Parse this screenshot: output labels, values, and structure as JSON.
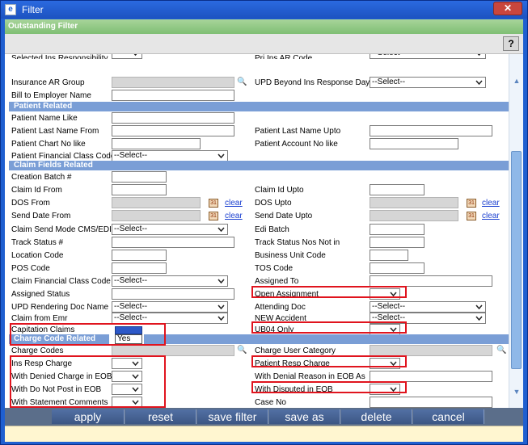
{
  "window": {
    "title": "Filter",
    "close_label": "✕",
    "icon_label": "e"
  },
  "header": {
    "title": "Outstanding Filter"
  },
  "toolbar": {
    "help_label": "?"
  },
  "select_placeholder": "--Select--",
  "rows": {
    "selected_ins_responsibility": "Selected Ins Responsibility",
    "pri_ins_ar_code": "Pri Ins AR Code",
    "insurance_ar_group": "Insurance AR Group",
    "upd_beyond": "UPD Beyond Ins Response Days",
    "bill_to_employer": "Bill to Employer Name"
  },
  "patient": {
    "section": "Patient Related",
    "name_like": "Patient Name Like",
    "last_name_from": "Patient Last Name From",
    "last_name_upto": "Patient Last Name Upto",
    "chart_no_like": "Patient Chart No like",
    "account_no_like": "Patient Account No like",
    "financial_class_code": "Patient Financial Class Code"
  },
  "claim": {
    "section": "Claim Fields Related",
    "creation_batch": "Creation Batch #",
    "claim_id_from": "Claim Id From",
    "claim_id_upto": "Claim Id Upto",
    "dos_from": "DOS From",
    "dos_upto": "DOS Upto",
    "send_date_from": "Send Date From",
    "send_date_upto": "Send Date Upto",
    "send_mode": "Claim Send Mode CMS/EDI",
    "edi_batch": "Edi Batch",
    "track_status": "Track Status #",
    "track_status_not_in": "Track Status Nos Not in",
    "location_code": "Location Code",
    "business_unit_code": "Business Unit Code",
    "pos_code": "POS Code",
    "tos_code": "TOS Code",
    "financial_class_code": "Claim Financial Class Code",
    "assigned_to": "Assigned To",
    "assigned_status": "Assigned Status",
    "open_assignment": "Open Assignment",
    "upd_rendering_doc": "UPD Rendering Doc Name",
    "attending_doc": "Attending Doc",
    "claim_from_emr": "Claim from Emr",
    "new_accident": "NEW Accident",
    "capitation_claims": "Capitation Claims",
    "capitation_value": "Yes",
    "ub04_only": "UB04 Only"
  },
  "charge": {
    "section": "Charge Code Related",
    "charge_codes": "Charge Codes",
    "charge_user_category": "Charge User Category",
    "ins_resp_charge": "Ins Resp Charge",
    "patient_resp_charge": "Patient Resp Charge",
    "with_denied_charge": "With Denied Charge in EOB",
    "with_denial_reason": "With Denial Reason in EOB As",
    "with_do_not_post": "With Do Not Post in EOB",
    "with_disputed": "With Disputed in EOB",
    "with_statement_comments": "With Statement Comments",
    "case_no": "Case No"
  },
  "links": {
    "clear": "clear"
  },
  "footer": {
    "apply": "apply",
    "reset": "reset",
    "save_filter": "save filter",
    "save_as": "save as",
    "delete": "delete",
    "cancel": "cancel"
  },
  "colors": {
    "section": "#7a9ed6",
    "highlight": "#e0141e",
    "footer": "#3c5684"
  }
}
